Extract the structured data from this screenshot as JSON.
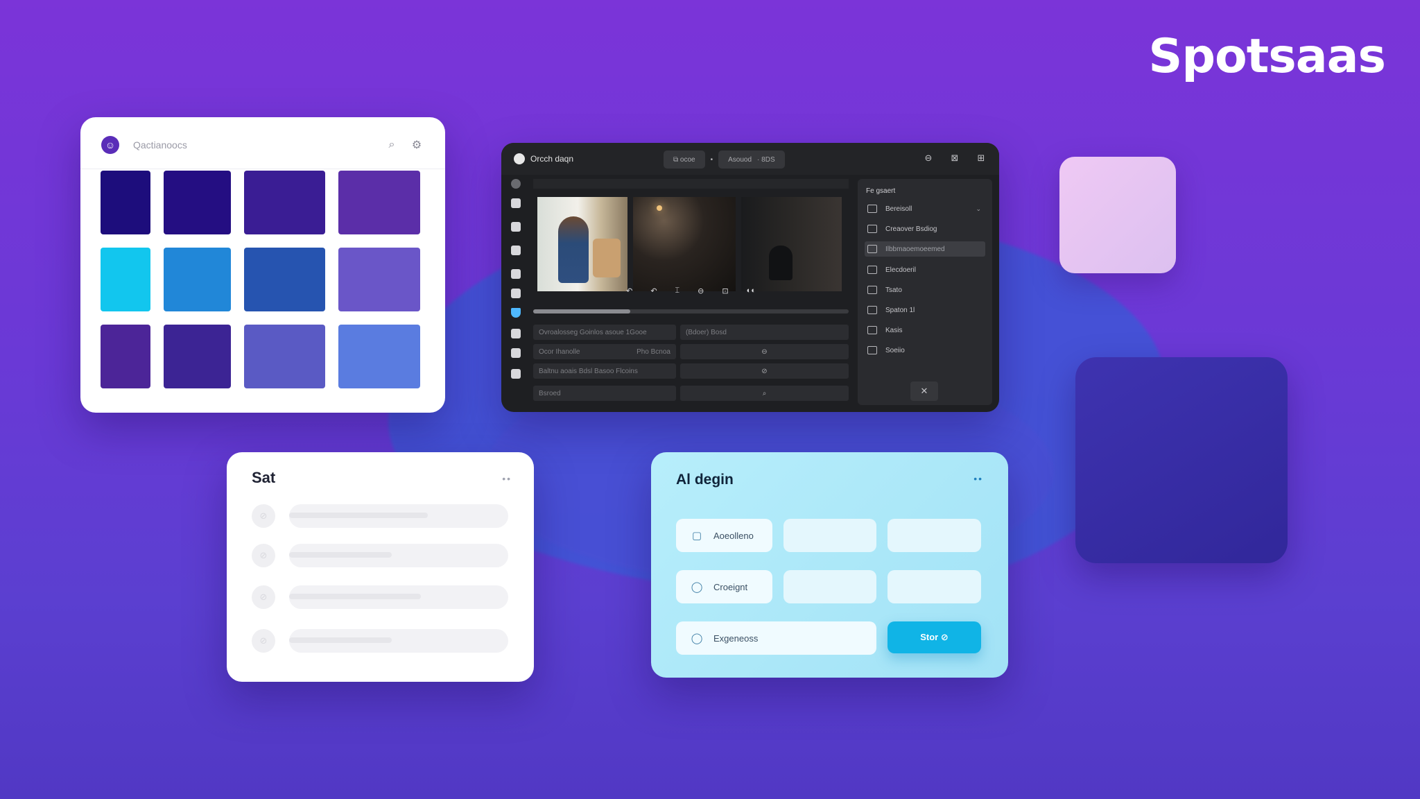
{
  "brand": {
    "name": "Spotsaas"
  },
  "palette_card": {
    "title": "Qactianoocs",
    "logo_glyph": "☺",
    "search_icon": "⌕",
    "settings_icon": "⚙",
    "swatches": [
      "#1d0d7c",
      "#240e82",
      "#3a1d94",
      "#5b2ea8",
      "#12c6ee",
      "#2187d8",
      "#2654b0",
      "#6a56c8",
      "#4c2598",
      "#3c2494",
      "#5a5ac4",
      "#5a7ce0"
    ]
  },
  "editor": {
    "title": "Orcch daqn",
    "tabs": [
      {
        "label": "⧉ ocoe"
      },
      {
        "label": "Asouod"
      },
      {
        "label": "· 8DS"
      }
    ],
    "top_icons": [
      "⊖",
      "⊠",
      "⊞"
    ],
    "controls": [
      "↶",
      "↶",
      "⌶",
      "⊖",
      "⊡",
      "◐◐"
    ],
    "rows": [
      {
        "left": "Ovroalosseg  Goinlos  asoue  1Gooe",
        "right": "(Bdoer)  Bosd"
      },
      {
        "left": "Ocor Ihanolle",
        "mid": "Pho  Bcnoa",
        "right": "⊖"
      },
      {
        "left": "Baltnu aoais  Bdsl  Basoo  Flcoins",
        "right": "⊘"
      },
      {
        "left": "Bsroed",
        "right": "⌕"
      }
    ],
    "panel": {
      "header": "Fe gsaert",
      "items": [
        "Bereisoll",
        "Creaover Bsdiog",
        "Ilbbmaoemoeemed",
        "Elecdoeril",
        "Tsato",
        "Spaton 1l",
        "Kasis",
        "Soeiio"
      ],
      "bottom_icon": "✕"
    }
  },
  "list_card": {
    "title": "Sat",
    "menu": "••",
    "avatars": [
      "⊘",
      "⊘",
      "⊘",
      "⊘"
    ]
  },
  "ai_card": {
    "title": "Al degin",
    "menu": "••",
    "chips": [
      {
        "label": "Aoeolleno",
        "icon": "▢"
      },
      {
        "label": "Croeignt",
        "icon": "◯"
      },
      {
        "label": "Exgeneoss",
        "icon": "◯"
      }
    ],
    "cta": "Stor ⊘"
  },
  "colors": {
    "bg_top": "#7b34d8",
    "bg_bottom": "#5138c4",
    "blob": "#3f56d6",
    "tile_light": "#e7c4f2",
    "tile_dark": "#3a2ea6",
    "cta": "#10b4e6"
  }
}
